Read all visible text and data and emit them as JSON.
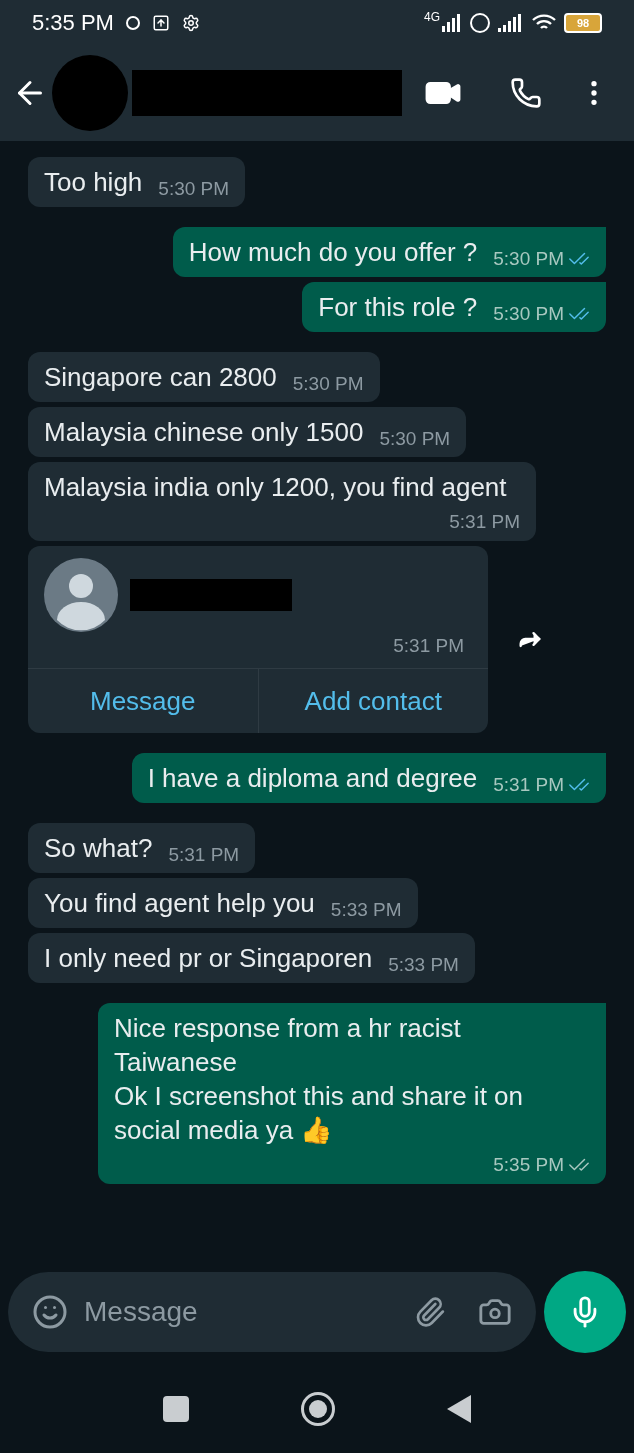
{
  "status_bar": {
    "time": "5:35 PM",
    "network": "4G",
    "battery": "98"
  },
  "messages": [
    {
      "kind": "text",
      "outgoing": false,
      "text": "Too high",
      "time": "5:30 PM"
    },
    {
      "kind": "text",
      "outgoing": true,
      "text": "How much do you offer ?",
      "time": "5:30 PM",
      "read": true
    },
    {
      "kind": "text",
      "outgoing": true,
      "text": "For this role ?",
      "time": "5:30 PM",
      "read": true
    },
    {
      "kind": "text",
      "outgoing": false,
      "text": "Singapore can 2800",
      "time": "5:30 PM"
    },
    {
      "kind": "text",
      "outgoing": false,
      "text": "Malaysia chinese only 1500",
      "time": "5:30 PM"
    },
    {
      "kind": "text",
      "outgoing": false,
      "text": "Malaysia india only 1200, you find agent",
      "time": "5:31 PM"
    },
    {
      "kind": "contact",
      "outgoing": false,
      "time": "5:31 PM",
      "actions": [
        "Message",
        "Add contact"
      ]
    },
    {
      "kind": "text",
      "outgoing": true,
      "text": "I have a diploma and degree",
      "time": "5:31 PM",
      "read": true
    },
    {
      "kind": "text",
      "outgoing": false,
      "text": "So what?",
      "time": "5:31 PM"
    },
    {
      "kind": "text",
      "outgoing": false,
      "text": "You find agent help you",
      "time": "5:33 PM"
    },
    {
      "kind": "text",
      "outgoing": false,
      "text": "I only need pr or Singaporen",
      "time": "5:33 PM"
    },
    {
      "kind": "text",
      "outgoing": true,
      "text": "Nice response from a hr racist\nTaiwanese\nOk I screenshot this and share it on social media ya 👍",
      "time": "5:35 PM",
      "read": false
    }
  ],
  "composer": {
    "placeholder": "Message"
  }
}
